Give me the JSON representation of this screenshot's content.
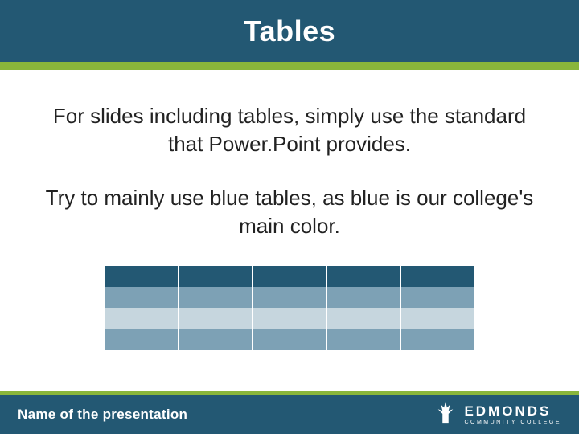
{
  "title": "Tables",
  "body": {
    "p1": "For slides including tables, simply use the standard that Power.Point provides.",
    "p2": "Try to mainly use blue tables, as blue is our college's main color."
  },
  "table": {
    "columns": 5,
    "header_rows": 1,
    "body_rows": 3,
    "header_bg": "#235873",
    "row_alt_bg": [
      "#7da1b5",
      "#c6d6de"
    ]
  },
  "footer": {
    "presentation_name": "Name of the presentation",
    "logo": {
      "name": "EDMONDS",
      "subtitle": "COMMUNITY COLLEGE"
    }
  },
  "colors": {
    "brand_blue": "#235873",
    "accent_green": "#89b63b"
  }
}
